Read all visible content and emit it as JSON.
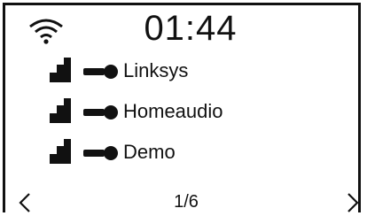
{
  "status_bar": {
    "wifi_icon": "wifi-icon",
    "time": "01:44"
  },
  "networks": [
    {
      "ssid": "Linksys",
      "signal_icon": "signal-strength-icon",
      "security_icon": "key-icon"
    },
    {
      "ssid": "Homeaudio",
      "signal_icon": "signal-strength-icon",
      "security_icon": "key-icon"
    },
    {
      "ssid": "Demo",
      "signal_icon": "signal-strength-icon",
      "security_icon": "key-icon"
    }
  ],
  "pagination": {
    "prev_icon": "chevron-left-icon",
    "next_icon": "chevron-right-icon",
    "page": "1/6"
  },
  "colors": {
    "foreground": "#111111",
    "background": "#ffffff"
  }
}
